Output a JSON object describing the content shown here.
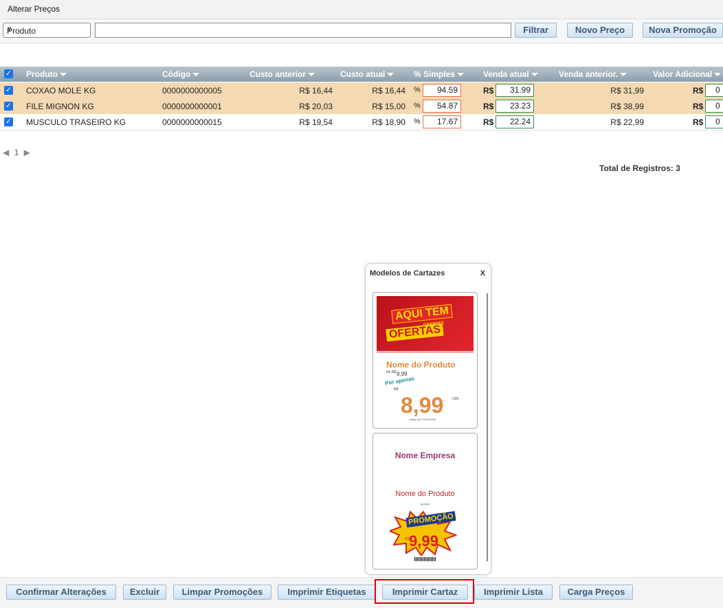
{
  "window": {
    "title": "Alterar Preços"
  },
  "filter": {
    "field": "Produto",
    "search_value": "",
    "filter_btn": "Filtrar",
    "new_price_btn": "Novo Preço",
    "new_promo_btn": "Nova Promoção"
  },
  "columns": [
    "Produto",
    "Código",
    "Custo anterior",
    "Custo atual",
    "% Simples",
    "Venda atual",
    "Venda anterior.",
    "Valor Adicional"
  ],
  "rows": [
    {
      "produto": "COXAO MOLE KG",
      "codigo": "0000000000005",
      "custo_anterior": "R$ 16,44",
      "custo_atual": "R$ 16,44",
      "pct_symbol": "%",
      "pct_simples": "94.59",
      "currency": "R$",
      "venda_atual": "31.99",
      "venda_anterior": "R$ 31,99",
      "valor_adicional": "0"
    },
    {
      "produto": "FILE MIGNON KG",
      "codigo": "0000000000001",
      "custo_anterior": "R$ 20,03",
      "custo_atual": "R$ 15,00",
      "pct_symbol": "%",
      "pct_simples": "54.87",
      "currency": "R$",
      "venda_atual": "23.23",
      "venda_anterior": "R$ 38,99",
      "valor_adicional": "0"
    },
    {
      "produto": "MUSCULO TRASEIRO KG",
      "codigo": "0000000000015",
      "custo_anterior": "R$ 19,54",
      "custo_atual": "R$ 18,90",
      "pct_symbol": "%",
      "pct_simples": "17.67",
      "currency": "R$",
      "venda_atual": "22.24",
      "venda_anterior": "R$ 22,99",
      "valor_adicional": "0"
    }
  ],
  "pager": {
    "page": "1"
  },
  "total": "Total de Registros: 3",
  "modal": {
    "title": "Modelos de Cartazes",
    "close": "X",
    "card1": {
      "line1": "AQUI TEM",
      "line2": "GRANDES",
      "line3": "OFERTAS",
      "product": "Nome do Produto",
      "de_label": "De R$",
      "de_value": "9,99",
      "por": "Por apenas",
      "rs": "R$",
      "price": "8,99",
      "unit": "/ UN",
      "validity": "Válido até 01/02/2000"
    },
    "card2": {
      "company": "Nome Empresa",
      "product": "Nome do Produto",
      "small": "Apenas",
      "promo": "PROMOÇÃO",
      "rs": "R$",
      "price": "9,99"
    }
  },
  "actions": [
    "Confirmar Alterações",
    "Excluir",
    "Limpar Promoções",
    "Imprimir Etiquetas",
    "Imprimir Cartaz",
    "Imprimir Lista",
    "Carga Preços"
  ],
  "colors": {
    "row_highlight": "#f5d9b3",
    "header_bg": "#9aabb7",
    "button_text": "#3a5a78",
    "checkbox": "#1a73e8",
    "selection_outline": "#e00000"
  }
}
